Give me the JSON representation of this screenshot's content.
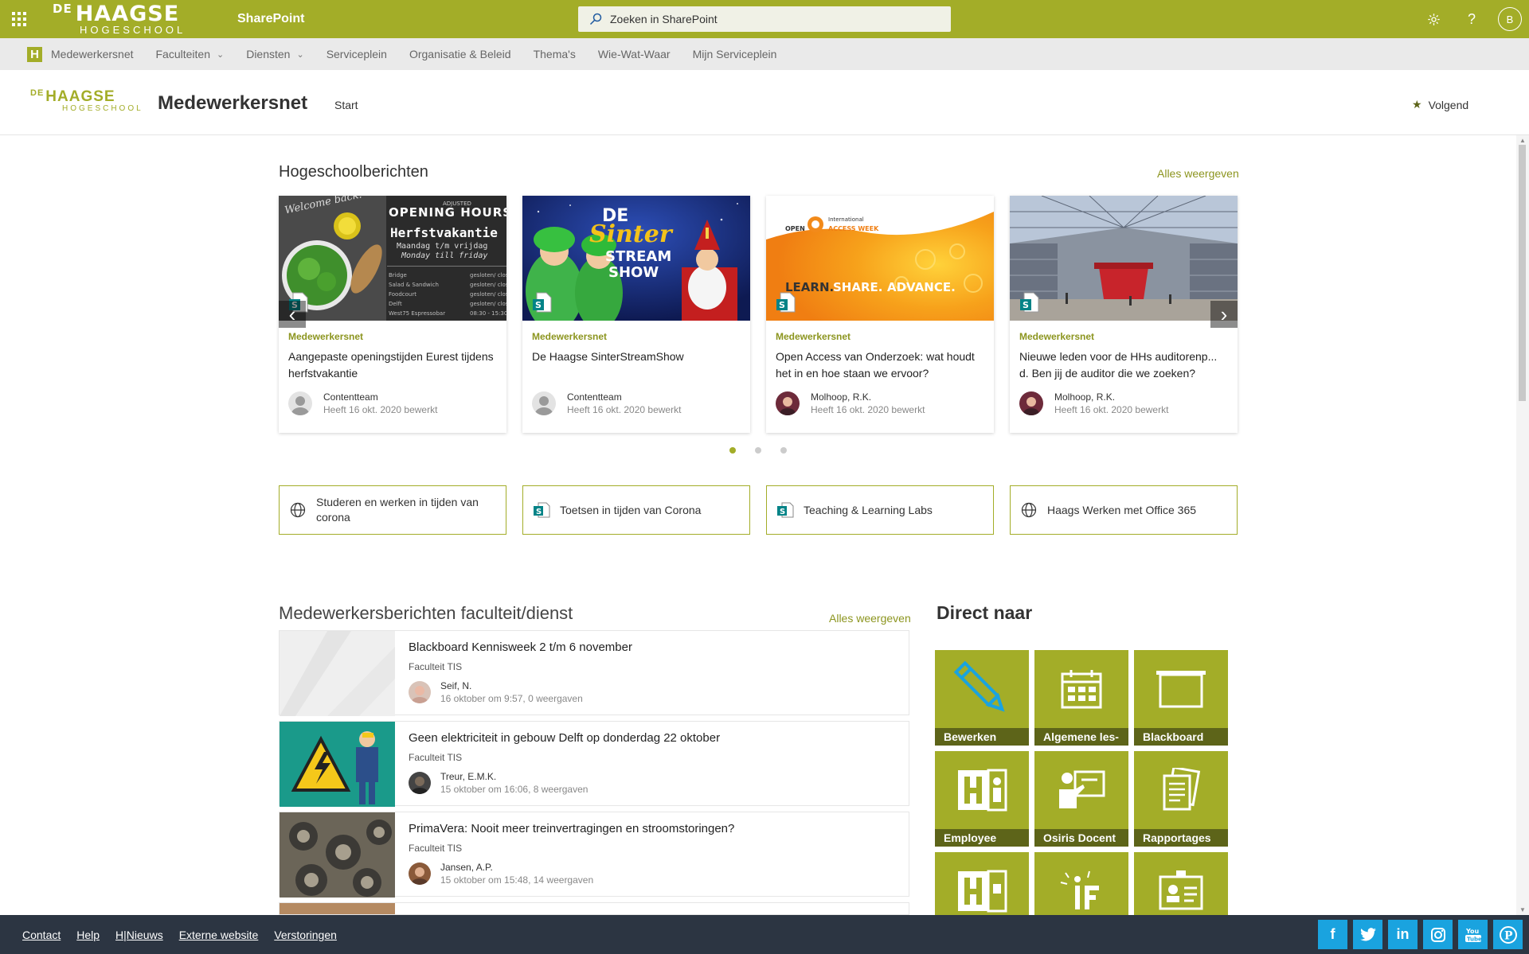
{
  "suitebar": {
    "brand_de": "DE",
    "brand_haagse": "HAAGSE",
    "brand_hogeschool": "HOGESCHOOL",
    "app_name": "SharePoint",
    "search_placeholder": "Zoeken in SharePoint",
    "avatar_initial": "B",
    "bg_color": "#a3ad28"
  },
  "hubnav": {
    "items": [
      "Medewerkersnet",
      "Faculteiten",
      "Diensten",
      "Serviceplein",
      "Organisatie & Beleid",
      "Thema's",
      "Wie-Wat-Waar",
      "Mijn Serviceplein"
    ]
  },
  "site": {
    "logo_de": "DE",
    "logo_haagse": "HAAGSE",
    "logo_hogeschool": "HOGESCHOOL",
    "title": "Medewerkersnet",
    "nav_start": "Start",
    "follow_label": "Volgend"
  },
  "news": {
    "title": "Hogeschoolberichten",
    "see_all": "Alles weergeven",
    "cards": [
      {
        "category": "Medewerkersnet",
        "title": "Aangepaste openingstijden Eurest tijdens herfstvakantie",
        "author": "Contentteam",
        "date": "Heeft 16 okt. 2020 bewerkt"
      },
      {
        "category": "Medewerkersnet",
        "title": "De Haagse SinterStreamShow",
        "author": "Contentteam",
        "date": "Heeft 16 okt. 2020 bewerkt"
      },
      {
        "category": "Medewerkersnet",
        "title": "Open Access van Onderzoek: wat houdt het in en hoe staan we ervoor?",
        "author": "Molhoop, R.K.",
        "date": "Heeft 16 okt. 2020 bewerkt"
      },
      {
        "category": "Medewerkersnet",
        "title": "Nieuwe leden voor de HHs auditorenp... d. Ben jij de auditor die we zoeken?",
        "author": "Molhoop, R.K.",
        "date": "Heeft 16 okt. 2020 bewerkt"
      }
    ],
    "card1_img": {
      "l1": "ADJUSTED",
      "l2": "OPENING HOURS",
      "l3": "Herfstvakantie",
      "l4": "Maandag t/m vrijdag",
      "l5": "Monday till friday",
      "script": "Welcome back!"
    },
    "card2_img": {
      "l1": "DE",
      "l2": "Sinter",
      "l3": "STREAM",
      "l4": "SHOW"
    },
    "card3_img": {
      "l1": "International",
      "l2": "OPEN",
      "l3": "ACCESS WEEK",
      "learn": "LEARN.",
      "share": "SHARE.",
      "advance": "ADVANCE."
    }
  },
  "quicklinks": [
    {
      "label": "Studeren en werken in tijden van corona",
      "icon": "globe-icon"
    },
    {
      "label": "Toetsen in tijden van Corona",
      "icon": "sharepoint-icon"
    },
    {
      "label": "Teaching & Learning Labs",
      "icon": "sharepoint-icon"
    },
    {
      "label": "Haags Werken met Office 365",
      "icon": "globe-icon"
    }
  ],
  "staffnews": {
    "title": "Medewerkersberichten faculteit/dienst",
    "see_all": "Alles weergeven",
    "items": [
      {
        "title": "Blackboard Kennisweek 2 t/m 6 november",
        "faculty": "Faculteit TIS",
        "author": "Seif, N.",
        "meta": "16 oktober om 9:57, 0 weergaven"
      },
      {
        "title": "Geen elektriciteit in gebouw Delft op donderdag 22 oktober",
        "faculty": "Faculteit TIS",
        "author": "Treur, E.M.K.",
        "meta": "15 oktober om 16:06, 8 weergaven"
      },
      {
        "title": "PrimaVera: Nooit meer treinvertragingen en stroomstoringen?",
        "faculty": "Faculteit TIS",
        "author": "Jansen, A.P.",
        "meta": "15 oktober om 15:48, 14 weergaven"
      }
    ]
  },
  "direct": {
    "title": "Direct naar",
    "tiles": [
      {
        "label": "Bewerken",
        "icon": "pencil-icon"
      },
      {
        "label": "Algemene les-",
        "icon": "calendar-icon"
      },
      {
        "label": "Blackboard",
        "icon": "blackboard-icon"
      },
      {
        "label": "Employee",
        "icon": "employee-icon"
      },
      {
        "label": "Osiris Docent",
        "icon": "teacher-icon"
      },
      {
        "label": "Rapportages",
        "icon": "reports-icon"
      }
    ]
  },
  "footer": {
    "links": [
      "Contact",
      "Help",
      "H|Nieuws",
      "Externe website",
      "Verstoringen"
    ],
    "socials": [
      "facebook-icon",
      "twitter-icon",
      "linkedin-icon",
      "instagram-icon",
      "youtube-icon",
      "pinterest-icon"
    ]
  }
}
